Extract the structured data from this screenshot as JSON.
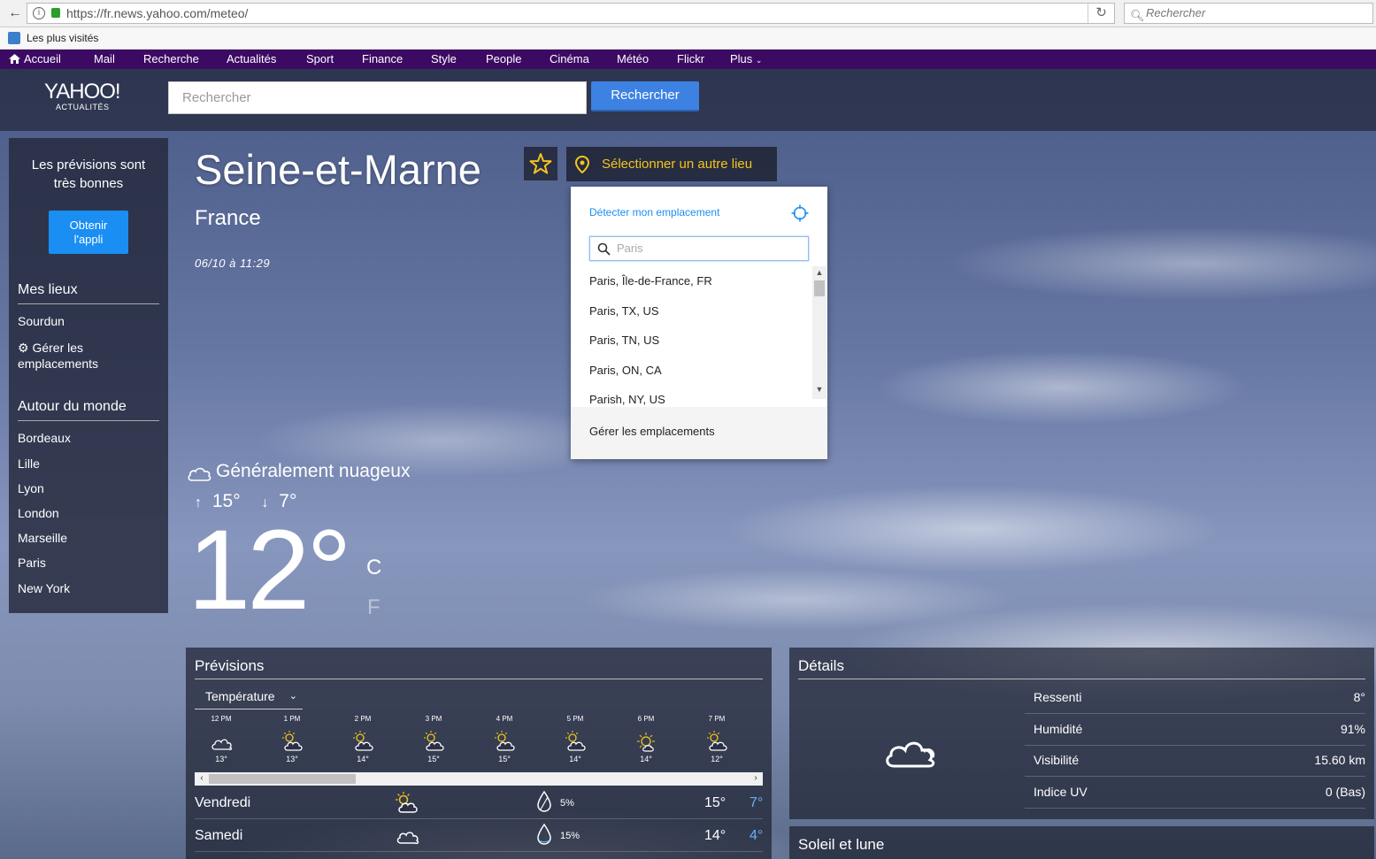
{
  "browser": {
    "url": "https://fr.news.yahoo.com/meteo/",
    "search_placeholder": "Rechercher",
    "bookmark": "Les plus visités"
  },
  "topnav": [
    "Accueil",
    "Mail",
    "Recherche",
    "Actualités",
    "Sport",
    "Finance",
    "Style",
    "People",
    "Cinéma",
    "Météo",
    "Flickr",
    "Plus"
  ],
  "header": {
    "logo": "YAHOO!",
    "logo_sub": "ACTUALITÉS",
    "search_placeholder": "Rechercher",
    "search_button": "Rechercher"
  },
  "sidebar": {
    "promo": "Les prévisions sont très bonnes",
    "app_button": "Obtenir l'appli",
    "mes_lieux": "Mes lieux",
    "my_places": [
      "Sourdun"
    ],
    "manage": "Gérer les emplacements",
    "world_title": "Autour du monde",
    "world": [
      "Bordeaux",
      "Lille",
      "Lyon",
      "London",
      "Marseille",
      "Paris",
      "New York"
    ]
  },
  "location": {
    "title": "Seine-et-Marne",
    "country": "France",
    "datetime": "06/10 à 11:29",
    "select_button": "Sélectionner un autre lieu"
  },
  "dropdown": {
    "detect": "Détecter mon emplacement",
    "input_placeholder": "Paris",
    "results": [
      "Paris, Île-de-France, FR",
      "Paris, TX, US",
      "Paris, TN, US",
      "Paris, ON, CA",
      "Parish, NY, US"
    ],
    "footer": "Gérer les emplacements"
  },
  "current": {
    "condition": "Généralement nuageux",
    "high": "15°",
    "low": "7°",
    "temp": "12°",
    "unit_c": "C",
    "unit_f": "F"
  },
  "forecast": {
    "title": "Prévisions",
    "select": "Température",
    "hourly": [
      {
        "time": "12 PM",
        "temp": "13°",
        "icon": "cloud-icon"
      },
      {
        "time": "1 PM",
        "temp": "13°",
        "icon": "partly-cloudy-icon"
      },
      {
        "time": "2 PM",
        "temp": "14°",
        "icon": "partly-cloudy-icon"
      },
      {
        "time": "3 PM",
        "temp": "15°",
        "icon": "partly-cloudy-icon"
      },
      {
        "time": "4 PM",
        "temp": "15°",
        "icon": "partly-cloudy-icon"
      },
      {
        "time": "5 PM",
        "temp": "14°",
        "icon": "partly-cloudy-icon"
      },
      {
        "time": "6 PM",
        "temp": "14°",
        "icon": "sun-icon"
      },
      {
        "time": "7 PM",
        "temp": "12°",
        "icon": "partly-cloudy-icon"
      }
    ],
    "daily": [
      {
        "day": "Vendredi",
        "icon": "partly-cloudy-icon",
        "precip": "5%",
        "high": "15°",
        "low": "7°"
      },
      {
        "day": "Samedi",
        "icon": "cloud-icon",
        "precip": "15%",
        "high": "14°",
        "low": "4°"
      }
    ]
  },
  "details": {
    "title": "Détails",
    "rows": [
      {
        "label": "Ressenti",
        "value": "8°"
      },
      {
        "label": "Humidité",
        "value": "91%"
      },
      {
        "label": "Visibilité",
        "value": "15.60 km"
      },
      {
        "label": "Indice UV",
        "value": "0 (Bas)"
      }
    ]
  },
  "sun_moon": {
    "title": "Soleil et lune"
  },
  "colors": {
    "nav_purple": "#3c0a63",
    "accent_blue": "#3d82e2",
    "star_yellow": "#f5c51c"
  }
}
